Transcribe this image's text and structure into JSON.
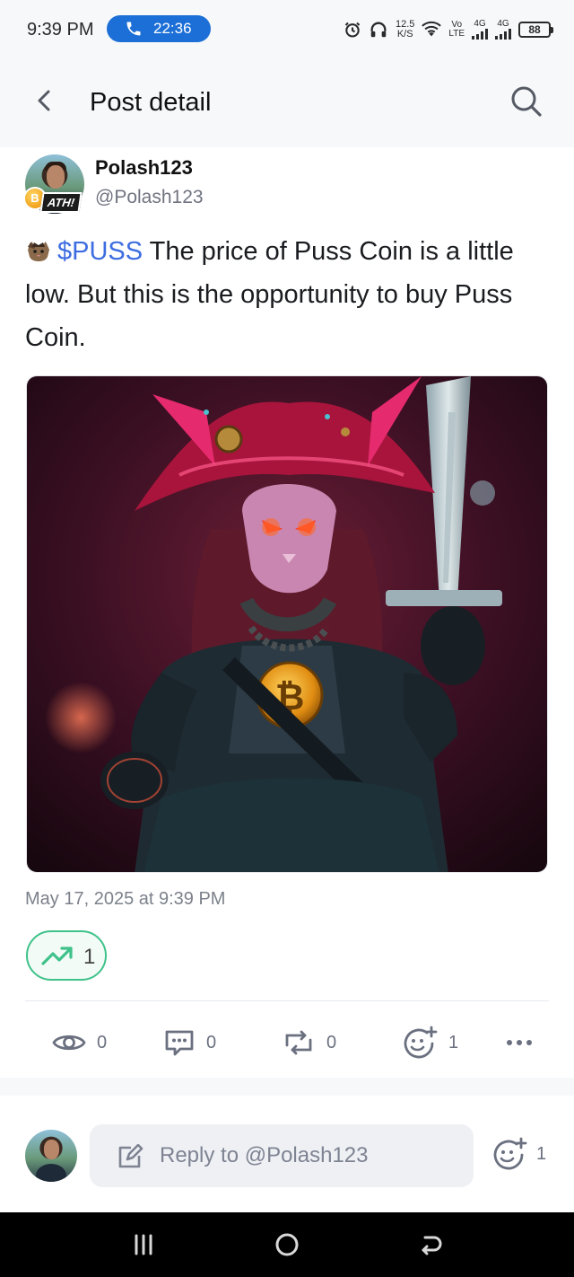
{
  "status_bar": {
    "time": "9:39 PM",
    "call_timer": "22:36",
    "speed_value": "12.5",
    "speed_unit": "K/S",
    "volte_top": "Vo",
    "volte_bottom": "LTE",
    "sim1_type": "4G",
    "sim2_type": "4G",
    "battery": "88"
  },
  "header": {
    "title": "Post detail",
    "back_icon": "chevron-left-icon",
    "search_icon": "search-icon"
  },
  "post": {
    "author_name": "Polash123",
    "author_handle": "@Polash123",
    "badge_label": "ATH!",
    "badge_coin": "B",
    "cashtag": "$PUSS",
    "text": " The price of Puss Coin is a little low. But this is the opportunity to buy Puss Coin.",
    "image_alt": "Pink pirate cat warrior holding a sword with a Bitcoin emblem",
    "date": "May 17, 2025 at 9:39 PM",
    "trend_count": "1",
    "trend_color": "#3fc28a",
    "cashtag_color": "#3d6de0"
  },
  "actions": {
    "views": "0",
    "comments": "0",
    "reposts": "0",
    "reactions": "1"
  },
  "reply": {
    "placeholder": "Reply to @Polash123",
    "reactions": "1"
  }
}
